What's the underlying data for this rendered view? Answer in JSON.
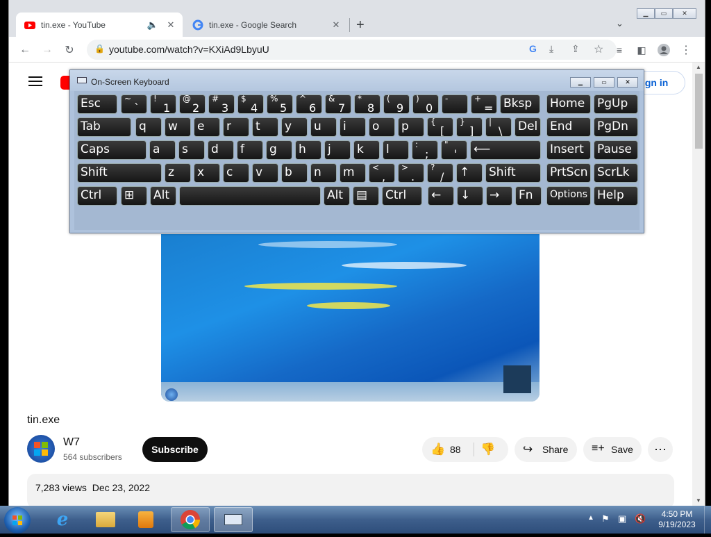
{
  "tabs": [
    {
      "title": "tin.exe - YouTube",
      "active": true
    },
    {
      "title": "tin.exe - Google Search",
      "active": false
    }
  ],
  "address": {
    "url": "youtube.com/watch?v=KXiAd9LbyuU"
  },
  "youtube": {
    "sign_in": "Sign in",
    "video_title": "tin.exe",
    "channel": {
      "name": "W7",
      "subscribers": "564 subscribers"
    },
    "subscribe": "Subscribe",
    "likes": "88",
    "share": "Share",
    "save": "Save",
    "views": "7,283 views",
    "date": "Dec 23, 2022"
  },
  "osk": {
    "title": "On-Screen Keyboard",
    "rows": [
      [
        [
          "Esc"
        ],
        [
          "~",
          "`"
        ],
        [
          "!",
          "1"
        ],
        [
          "@",
          "2"
        ],
        [
          "#",
          "3"
        ],
        [
          "$",
          "4"
        ],
        [
          "%",
          "5"
        ],
        [
          "^",
          "6"
        ],
        [
          "&",
          "7"
        ],
        [
          "*",
          "8"
        ],
        [
          "(",
          "9"
        ],
        [
          ")",
          "0"
        ],
        [
          "-",
          "_"
        ],
        [
          "+",
          "="
        ],
        [
          "Bksp"
        ],
        [
          "Home"
        ],
        [
          "PgUp"
        ]
      ],
      [
        [
          "Tab"
        ],
        [
          "q"
        ],
        [
          "w"
        ],
        [
          "e"
        ],
        [
          "r"
        ],
        [
          "t"
        ],
        [
          "y"
        ],
        [
          "u"
        ],
        [
          "i"
        ],
        [
          "o"
        ],
        [
          "p"
        ],
        [
          "{",
          "["
        ],
        [
          "}",
          "]"
        ],
        [
          "|",
          "\\"
        ],
        [
          "Del"
        ],
        [
          "End"
        ],
        [
          "PgDn"
        ]
      ],
      [
        [
          "Caps"
        ],
        [
          "a"
        ],
        [
          "s"
        ],
        [
          "d"
        ],
        [
          "f"
        ],
        [
          "g"
        ],
        [
          "h"
        ],
        [
          "j"
        ],
        [
          "k"
        ],
        [
          "l"
        ],
        [
          ":",
          ";"
        ],
        [
          "\"",
          "'"
        ],
        [
          "⟵"
        ],
        [
          "Insert"
        ],
        [
          "Pause"
        ]
      ],
      [
        [
          "Shift"
        ],
        [
          "z"
        ],
        [
          "x"
        ],
        [
          "c"
        ],
        [
          "v"
        ],
        [
          "b"
        ],
        [
          "n"
        ],
        [
          "m"
        ],
        [
          "<",
          ","
        ],
        [
          ">",
          "."
        ],
        [
          "?",
          "/"
        ],
        [
          "↑"
        ],
        [
          "Shift"
        ],
        [
          "PrtScn"
        ],
        [
          "ScrLk"
        ]
      ],
      [
        [
          "Ctrl"
        ],
        [
          "⊞"
        ],
        [
          "Alt"
        ],
        [
          ""
        ],
        [
          "Alt"
        ],
        [
          "▤"
        ],
        [
          "Ctrl"
        ],
        [
          "←"
        ],
        [
          "↓"
        ],
        [
          "→"
        ],
        [
          "Fn"
        ],
        [
          "Options"
        ],
        [
          "Help"
        ]
      ]
    ]
  },
  "clock": {
    "time": "4:50 PM",
    "date": "9/19/2023"
  }
}
